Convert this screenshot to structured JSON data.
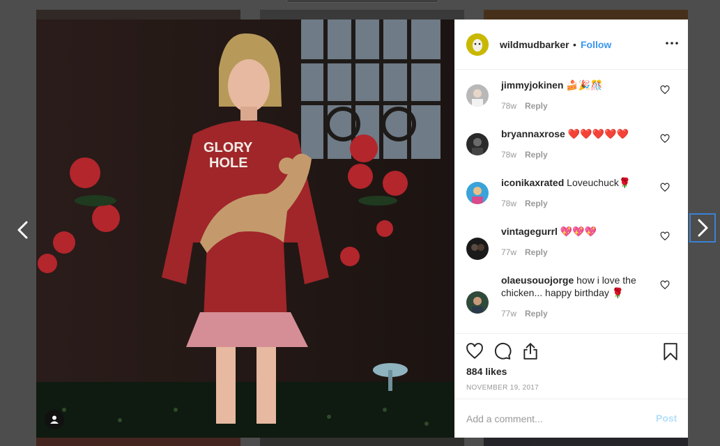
{
  "post": {
    "username": "wildmudbarker",
    "separator": "•",
    "follow_label": "Follow",
    "more_icon": "more-horizontal-icon",
    "likes_text": "884 likes",
    "date_text": "NOVEMBER 19, 2017",
    "photo_text": {
      "hoodie_line1": "GLORY",
      "hoodie_line2": "HOLE"
    }
  },
  "comments": [
    {
      "username": "jimmyjokinen",
      "text": "🍰🎉🎊",
      "age": "78w",
      "reply_label": "Reply"
    },
    {
      "username": "bryannaxrose",
      "text": "❤️❤️❤️❤️❤️",
      "age": "78w",
      "reply_label": "Reply"
    },
    {
      "username": "iconikaxrated",
      "text": "Loveuchuck🌹",
      "age": "78w",
      "reply_label": "Reply"
    },
    {
      "username": "vintagegurrl",
      "text": "💖💖💖",
      "age": "77w",
      "reply_label": "Reply"
    },
    {
      "username": "olaeusouojorge",
      "text": "how i love the chicken... happy birthday 🌹",
      "age": "77w",
      "reply_label": "Reply"
    }
  ],
  "composer": {
    "placeholder": "Add a comment...",
    "post_label": "Post"
  },
  "icons": {
    "like": "heart-icon",
    "comment": "comment-icon",
    "share": "share-icon",
    "save": "bookmark-icon",
    "prev": "chevron-left-icon",
    "next": "chevron-right-icon",
    "user_tag": "user-icon"
  },
  "colors": {
    "link_blue": "#3897f0",
    "post_disabled": "#b2dffc",
    "muted": "#999999",
    "text": "#262626"
  }
}
